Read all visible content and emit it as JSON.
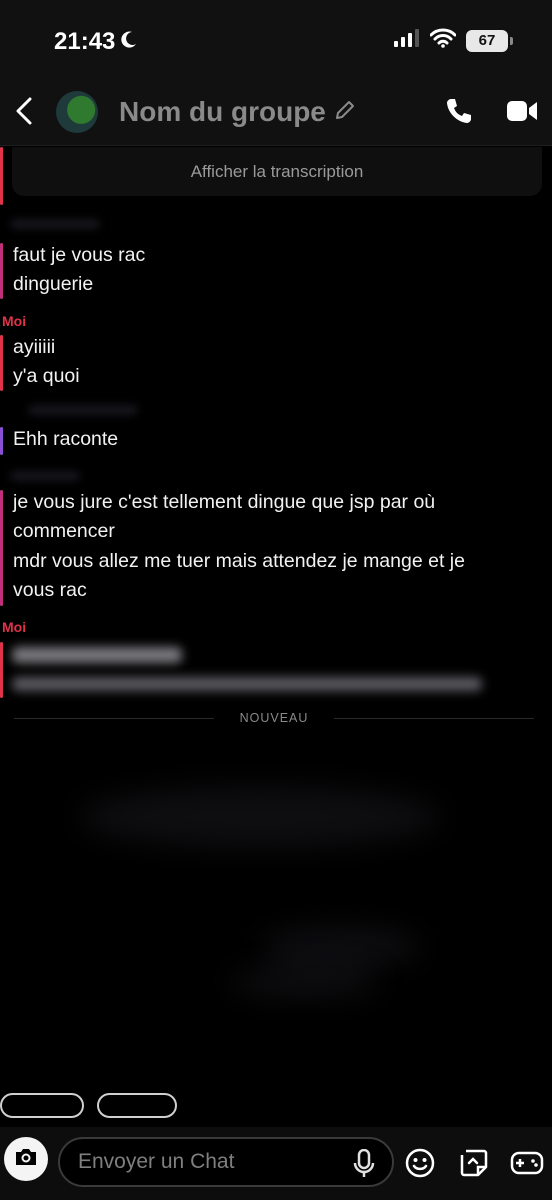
{
  "status_bar": {
    "time": "21:43",
    "battery": "67",
    "icons": [
      "moon-icon",
      "signal-icon",
      "wifi-icon",
      "battery-icon"
    ]
  },
  "header": {
    "group_name": "Nom du groupe",
    "icons": [
      "back-icon",
      "avatar",
      "pencil-icon",
      "phone-icon",
      "video-icon"
    ]
  },
  "chat": {
    "transcript_button": "Afficher la transcription",
    "messages": [
      {
        "sender": "",
        "lines": [
          "faut je vous rac",
          "dinguerie"
        ]
      },
      {
        "sender": "Moi",
        "lines": [
          "ayiiiii",
          "y'a quoi"
        ]
      },
      {
        "sender": "",
        "lines": [
          "Ehh raconte"
        ]
      },
      {
        "sender": "",
        "lines": [
          "je vous jure c'est tellement dingue que jsp par où",
          "commencer",
          "mdr vous allez me tuer mais attendez je mange et je",
          "vous rac"
        ]
      },
      {
        "sender": "Moi",
        "lines": []
      }
    ],
    "new_divider": "NOUVEAU"
  },
  "bottom_bar": {
    "chat_placeholder": "Envoyer un Chat",
    "icons": [
      "camera-icon",
      "mic-icon",
      "emoji-icon",
      "sticker-icon",
      "game-controller-icon"
    ]
  },
  "colors": {
    "background": "#000000",
    "accent_red": "#e0334a",
    "accent_purple": "#8a4fd6",
    "accent_magenta": "#c0307a"
  }
}
